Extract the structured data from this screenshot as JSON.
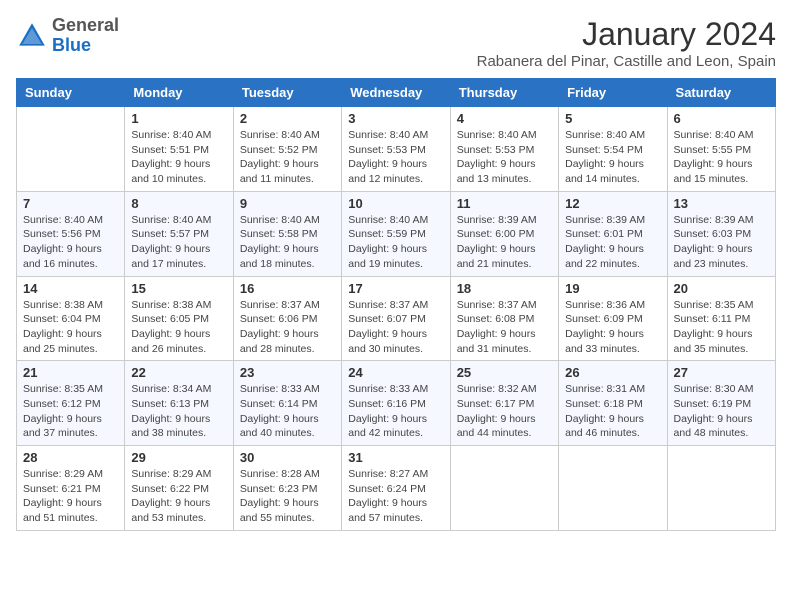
{
  "header": {
    "logo_general": "General",
    "logo_blue": "Blue",
    "month_title": "January 2024",
    "subtitle": "Rabanera del Pinar, Castille and Leon, Spain"
  },
  "days_of_week": [
    "Sunday",
    "Monday",
    "Tuesday",
    "Wednesday",
    "Thursday",
    "Friday",
    "Saturday"
  ],
  "weeks": [
    [
      {
        "day": "",
        "content": ""
      },
      {
        "day": "1",
        "sunrise": "Sunrise: 8:40 AM",
        "sunset": "Sunset: 5:51 PM",
        "daylight": "Daylight: 9 hours and 10 minutes."
      },
      {
        "day": "2",
        "sunrise": "Sunrise: 8:40 AM",
        "sunset": "Sunset: 5:52 PM",
        "daylight": "Daylight: 9 hours and 11 minutes."
      },
      {
        "day": "3",
        "sunrise": "Sunrise: 8:40 AM",
        "sunset": "Sunset: 5:53 PM",
        "daylight": "Daylight: 9 hours and 12 minutes."
      },
      {
        "day": "4",
        "sunrise": "Sunrise: 8:40 AM",
        "sunset": "Sunset: 5:53 PM",
        "daylight": "Daylight: 9 hours and 13 minutes."
      },
      {
        "day": "5",
        "sunrise": "Sunrise: 8:40 AM",
        "sunset": "Sunset: 5:54 PM",
        "daylight": "Daylight: 9 hours and 14 minutes."
      },
      {
        "day": "6",
        "sunrise": "Sunrise: 8:40 AM",
        "sunset": "Sunset: 5:55 PM",
        "daylight": "Daylight: 9 hours and 15 minutes."
      }
    ],
    [
      {
        "day": "7",
        "sunrise": "Sunrise: 8:40 AM",
        "sunset": "Sunset: 5:56 PM",
        "daylight": "Daylight: 9 hours and 16 minutes."
      },
      {
        "day": "8",
        "sunrise": "Sunrise: 8:40 AM",
        "sunset": "Sunset: 5:57 PM",
        "daylight": "Daylight: 9 hours and 17 minutes."
      },
      {
        "day": "9",
        "sunrise": "Sunrise: 8:40 AM",
        "sunset": "Sunset: 5:58 PM",
        "daylight": "Daylight: 9 hours and 18 minutes."
      },
      {
        "day": "10",
        "sunrise": "Sunrise: 8:40 AM",
        "sunset": "Sunset: 5:59 PM",
        "daylight": "Daylight: 9 hours and 19 minutes."
      },
      {
        "day": "11",
        "sunrise": "Sunrise: 8:39 AM",
        "sunset": "Sunset: 6:00 PM",
        "daylight": "Daylight: 9 hours and 21 minutes."
      },
      {
        "day": "12",
        "sunrise": "Sunrise: 8:39 AM",
        "sunset": "Sunset: 6:01 PM",
        "daylight": "Daylight: 9 hours and 22 minutes."
      },
      {
        "day": "13",
        "sunrise": "Sunrise: 8:39 AM",
        "sunset": "Sunset: 6:03 PM",
        "daylight": "Daylight: 9 hours and 23 minutes."
      }
    ],
    [
      {
        "day": "14",
        "sunrise": "Sunrise: 8:38 AM",
        "sunset": "Sunset: 6:04 PM",
        "daylight": "Daylight: 9 hours and 25 minutes."
      },
      {
        "day": "15",
        "sunrise": "Sunrise: 8:38 AM",
        "sunset": "Sunset: 6:05 PM",
        "daylight": "Daylight: 9 hours and 26 minutes."
      },
      {
        "day": "16",
        "sunrise": "Sunrise: 8:37 AM",
        "sunset": "Sunset: 6:06 PM",
        "daylight": "Daylight: 9 hours and 28 minutes."
      },
      {
        "day": "17",
        "sunrise": "Sunrise: 8:37 AM",
        "sunset": "Sunset: 6:07 PM",
        "daylight": "Daylight: 9 hours and 30 minutes."
      },
      {
        "day": "18",
        "sunrise": "Sunrise: 8:37 AM",
        "sunset": "Sunset: 6:08 PM",
        "daylight": "Daylight: 9 hours and 31 minutes."
      },
      {
        "day": "19",
        "sunrise": "Sunrise: 8:36 AM",
        "sunset": "Sunset: 6:09 PM",
        "daylight": "Daylight: 9 hours and 33 minutes."
      },
      {
        "day": "20",
        "sunrise": "Sunrise: 8:35 AM",
        "sunset": "Sunset: 6:11 PM",
        "daylight": "Daylight: 9 hours and 35 minutes."
      }
    ],
    [
      {
        "day": "21",
        "sunrise": "Sunrise: 8:35 AM",
        "sunset": "Sunset: 6:12 PM",
        "daylight": "Daylight: 9 hours and 37 minutes."
      },
      {
        "day": "22",
        "sunrise": "Sunrise: 8:34 AM",
        "sunset": "Sunset: 6:13 PM",
        "daylight": "Daylight: 9 hours and 38 minutes."
      },
      {
        "day": "23",
        "sunrise": "Sunrise: 8:33 AM",
        "sunset": "Sunset: 6:14 PM",
        "daylight": "Daylight: 9 hours and 40 minutes."
      },
      {
        "day": "24",
        "sunrise": "Sunrise: 8:33 AM",
        "sunset": "Sunset: 6:16 PM",
        "daylight": "Daylight: 9 hours and 42 minutes."
      },
      {
        "day": "25",
        "sunrise": "Sunrise: 8:32 AM",
        "sunset": "Sunset: 6:17 PM",
        "daylight": "Daylight: 9 hours and 44 minutes."
      },
      {
        "day": "26",
        "sunrise": "Sunrise: 8:31 AM",
        "sunset": "Sunset: 6:18 PM",
        "daylight": "Daylight: 9 hours and 46 minutes."
      },
      {
        "day": "27",
        "sunrise": "Sunrise: 8:30 AM",
        "sunset": "Sunset: 6:19 PM",
        "daylight": "Daylight: 9 hours and 48 minutes."
      }
    ],
    [
      {
        "day": "28",
        "sunrise": "Sunrise: 8:29 AM",
        "sunset": "Sunset: 6:21 PM",
        "daylight": "Daylight: 9 hours and 51 minutes."
      },
      {
        "day": "29",
        "sunrise": "Sunrise: 8:29 AM",
        "sunset": "Sunset: 6:22 PM",
        "daylight": "Daylight: 9 hours and 53 minutes."
      },
      {
        "day": "30",
        "sunrise": "Sunrise: 8:28 AM",
        "sunset": "Sunset: 6:23 PM",
        "daylight": "Daylight: 9 hours and 55 minutes."
      },
      {
        "day": "31",
        "sunrise": "Sunrise: 8:27 AM",
        "sunset": "Sunset: 6:24 PM",
        "daylight": "Daylight: 9 hours and 57 minutes."
      },
      {
        "day": "",
        "content": ""
      },
      {
        "day": "",
        "content": ""
      },
      {
        "day": "",
        "content": ""
      }
    ]
  ]
}
